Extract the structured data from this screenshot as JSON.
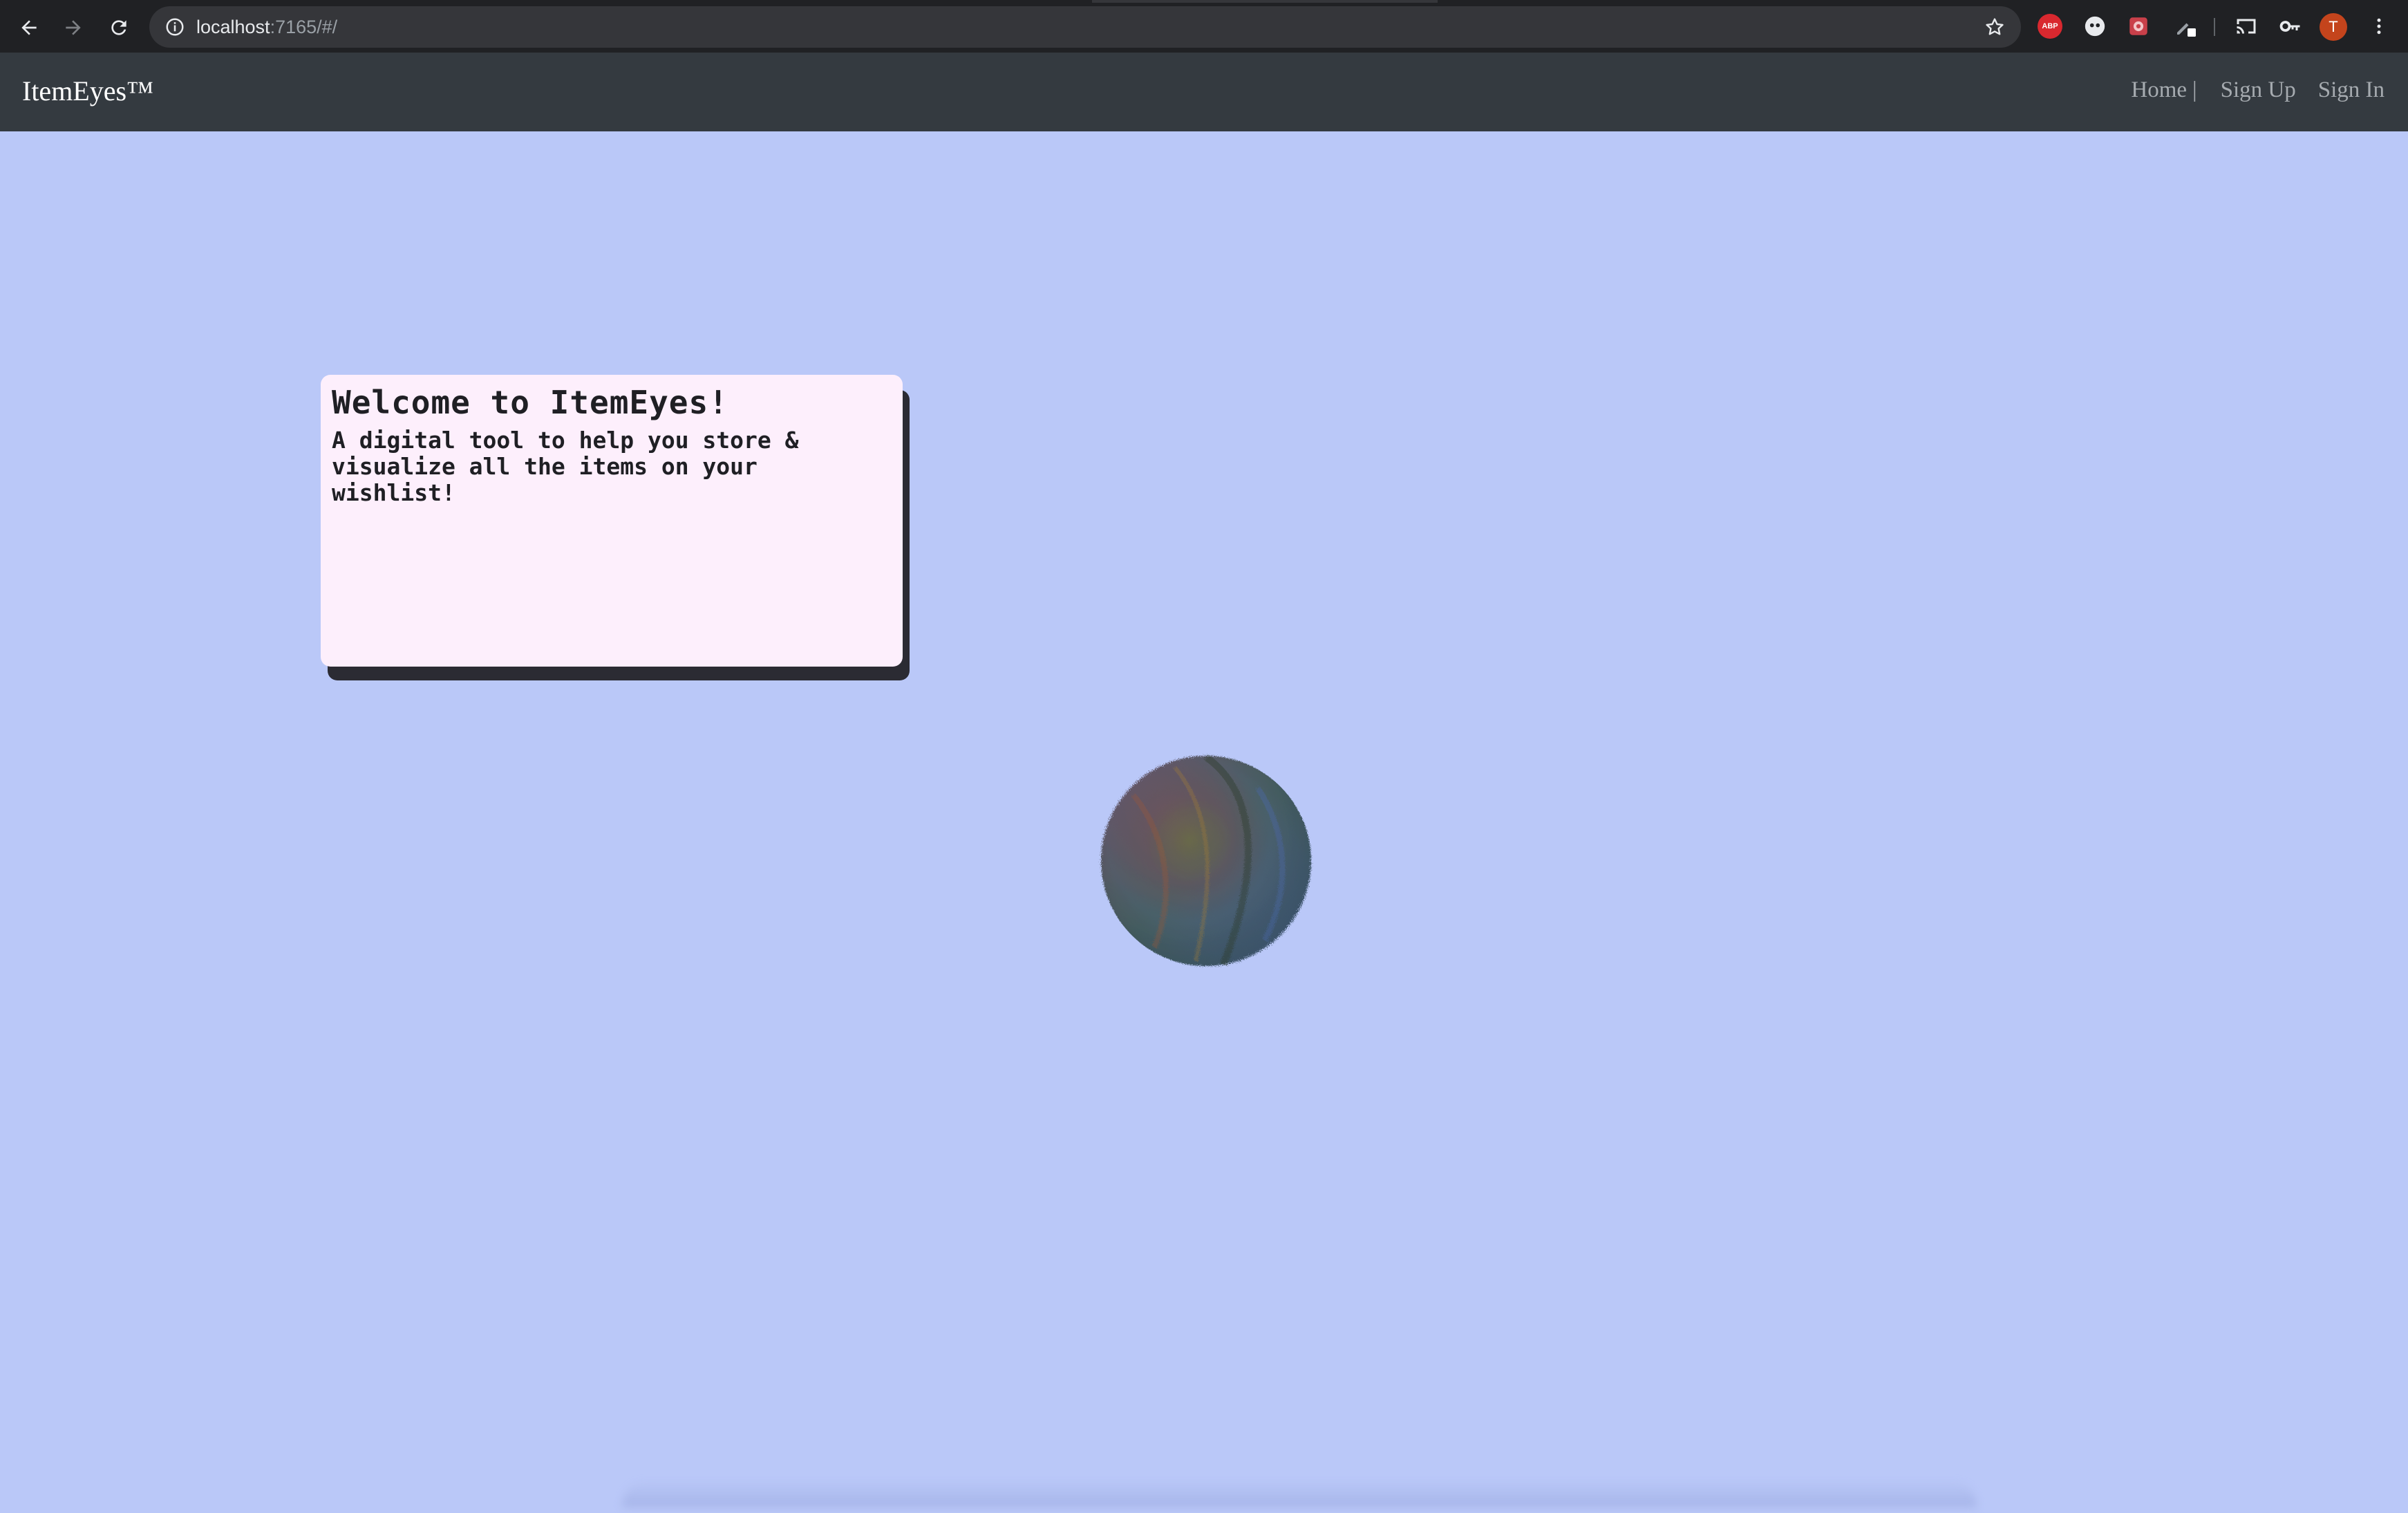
{
  "browser": {
    "url_host": "localhost",
    "url_rest": ":7165/#/",
    "avatar_initial": "T",
    "extensions": [
      "abp-icon",
      "ghostery-icon",
      "puzzle-extension-icon",
      "pen-icon"
    ],
    "abp_label": "ABP"
  },
  "navbar": {
    "brand": "ItemEyes™",
    "links": {
      "home": "Home",
      "separator": "|",
      "sign_up": "Sign Up",
      "sign_in": "Sign In"
    }
  },
  "welcome": {
    "title": "Welcome to ItemEyes!",
    "description": "A digital tool to help you store & visualize all the items on your wishlist!"
  },
  "colors": {
    "page_background": "#bac8f8",
    "navbar_background": "#343a40",
    "card_background": "#fdeffc",
    "card_shadow": "#2b2b33"
  }
}
